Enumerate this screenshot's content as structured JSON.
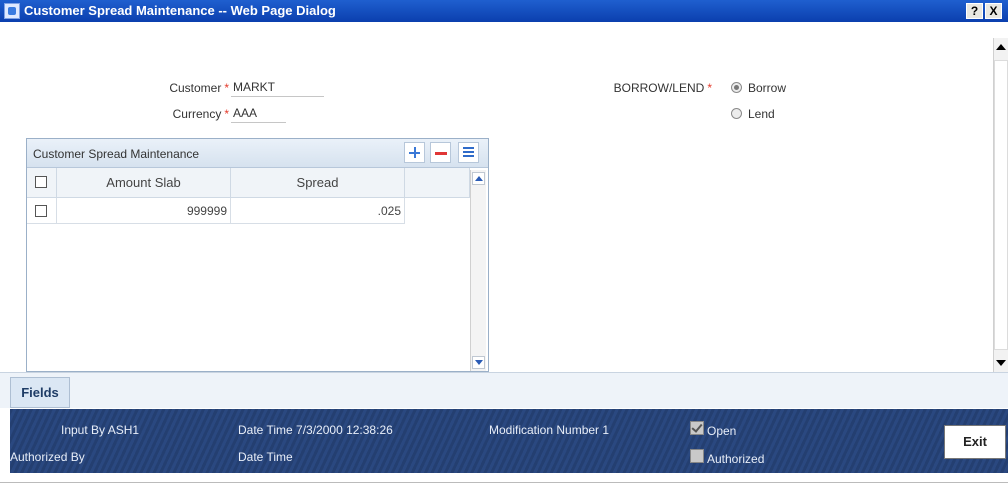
{
  "window": {
    "title": "Customer Spread Maintenance -- Web Page Dialog",
    "help_label": "?",
    "close_label": "X"
  },
  "form": {
    "customer_label": "Customer",
    "customer_value": "MARKT",
    "currency_label": "Currency",
    "currency_value": "AAA",
    "required_mark": "*",
    "borrow_lend_label": "BORROW/LEND",
    "options": [
      {
        "label": "Borrow",
        "selected": true
      },
      {
        "label": "Lend",
        "selected": false
      }
    ]
  },
  "grid": {
    "title": "Customer Spread Maintenance",
    "columns": [
      "Amount Slab",
      "Spread"
    ],
    "rows": [
      {
        "amount_slab": "999999",
        "spread": ".025",
        "checked": false
      }
    ]
  },
  "tabs": {
    "fields_label": "Fields"
  },
  "footer": {
    "input_by_label": "Input By",
    "input_by_value": "ASH1",
    "date_time_label": "Date Time",
    "date_time_value": "7/3/2000 12:38:26",
    "authorized_by_label": "Authorized By",
    "authorized_date_time_label": "Date Time",
    "modification_label": "Modification Number",
    "modification_value": "1",
    "open_label": "Open",
    "open_checked": true,
    "authorized_label": "Authorized",
    "authorized_checked": false,
    "exit_label": "Exit"
  }
}
